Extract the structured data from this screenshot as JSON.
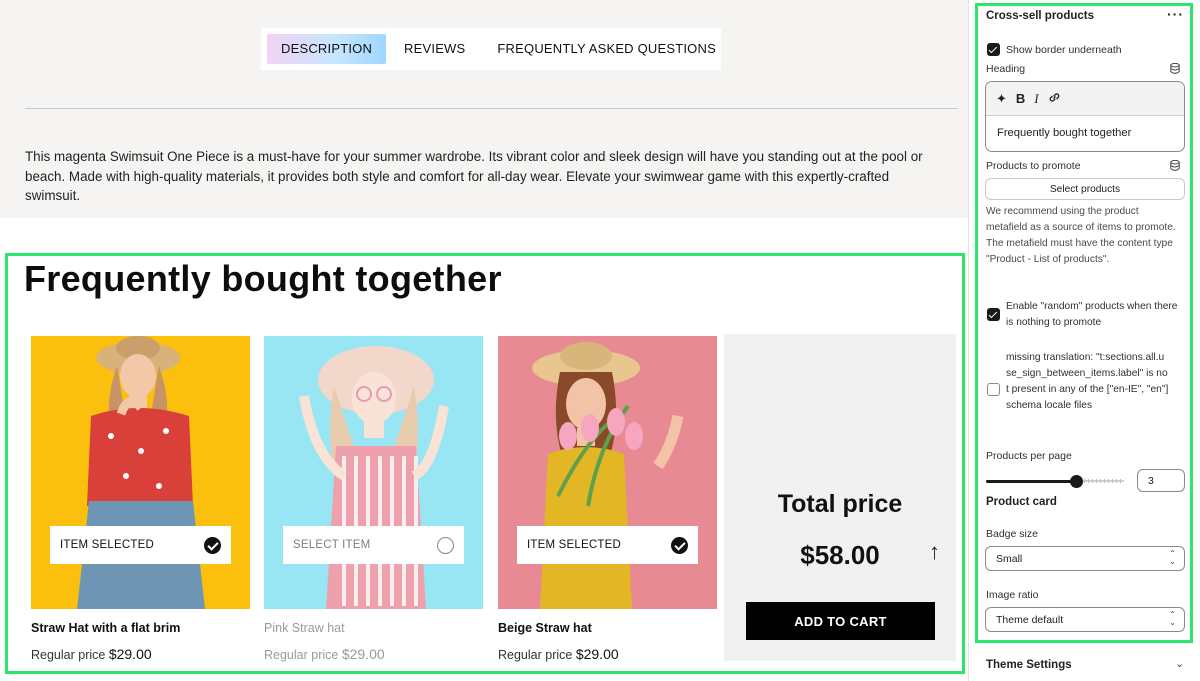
{
  "preview": {
    "tabs": [
      "DESCRIPTION",
      "REVIEWS",
      "FREQUENTLY ASKED QUESTIONS"
    ],
    "active_tab": "DESCRIPTION",
    "description": "This magenta Swimsuit One Piece is a must-have for your summer wardrobe. Its vibrant color and sleek design will have you standing out at the pool or beach. Made with high-quality materials, it provides both style and comfort for all-day wear. Elevate your swimwear game with this expertly-crafted swimsuit.",
    "heading": "Frequently bought together",
    "products": [
      {
        "name": "Straw Hat with a flat brim",
        "price_label": "Regular price",
        "price": "$29.00",
        "selection_label": "ITEM SELECTED",
        "selected": true,
        "bg_color": "#fbbf0d"
      },
      {
        "name": "Pink Straw hat",
        "price_label": "Regular price",
        "price": "$29.00",
        "selection_label": "SELECT ITEM",
        "selected": false,
        "bg_color": "#45d3ea"
      },
      {
        "name": "Beige Straw hat",
        "price_label": "Regular price",
        "price": "$29.00",
        "selection_label": "ITEM SELECTED",
        "selected": true,
        "bg_color": "#e88a93"
      }
    ],
    "total": {
      "title": "Total price",
      "amount": "$58.00",
      "button": "ADD TO CART"
    }
  },
  "sidebar": {
    "section_title": "Cross-sell products",
    "more_icon": "more-horizontal-icon",
    "show_border": {
      "label": "Show border underneath",
      "checked": true
    },
    "heading_field": {
      "label": "Heading",
      "value": "Frequently bought together"
    },
    "products_field": {
      "label": "Products to promote",
      "button": "Select products"
    },
    "help_text": "We recommend using the product metafield as a source of items to promote. The metafield must have the content type \"Product - List of products\".",
    "random_products": {
      "label": "Enable \"random\" products when there is nothing to promote",
      "checked": true
    },
    "missing_translation": {
      "label": "missing translation: \"t:sections.all.use_sign_between_items.label\" is not present in any of the [\"en-IE\", \"en\"] schema locale files",
      "checked": false
    },
    "per_page": {
      "label": "Products per page",
      "value": "3",
      "fraction": 0.65
    },
    "product_card_heading": "Product card",
    "badge_size": {
      "label": "Badge size",
      "value": "Small"
    },
    "image_ratio": {
      "label": "Image ratio",
      "value": "Theme default"
    },
    "theme_settings": "Theme Settings"
  },
  "colors": {
    "highlight": "#2ee56b",
    "accent_gradient": [
      "#f2d3f5",
      "#9fd6ff"
    ]
  }
}
